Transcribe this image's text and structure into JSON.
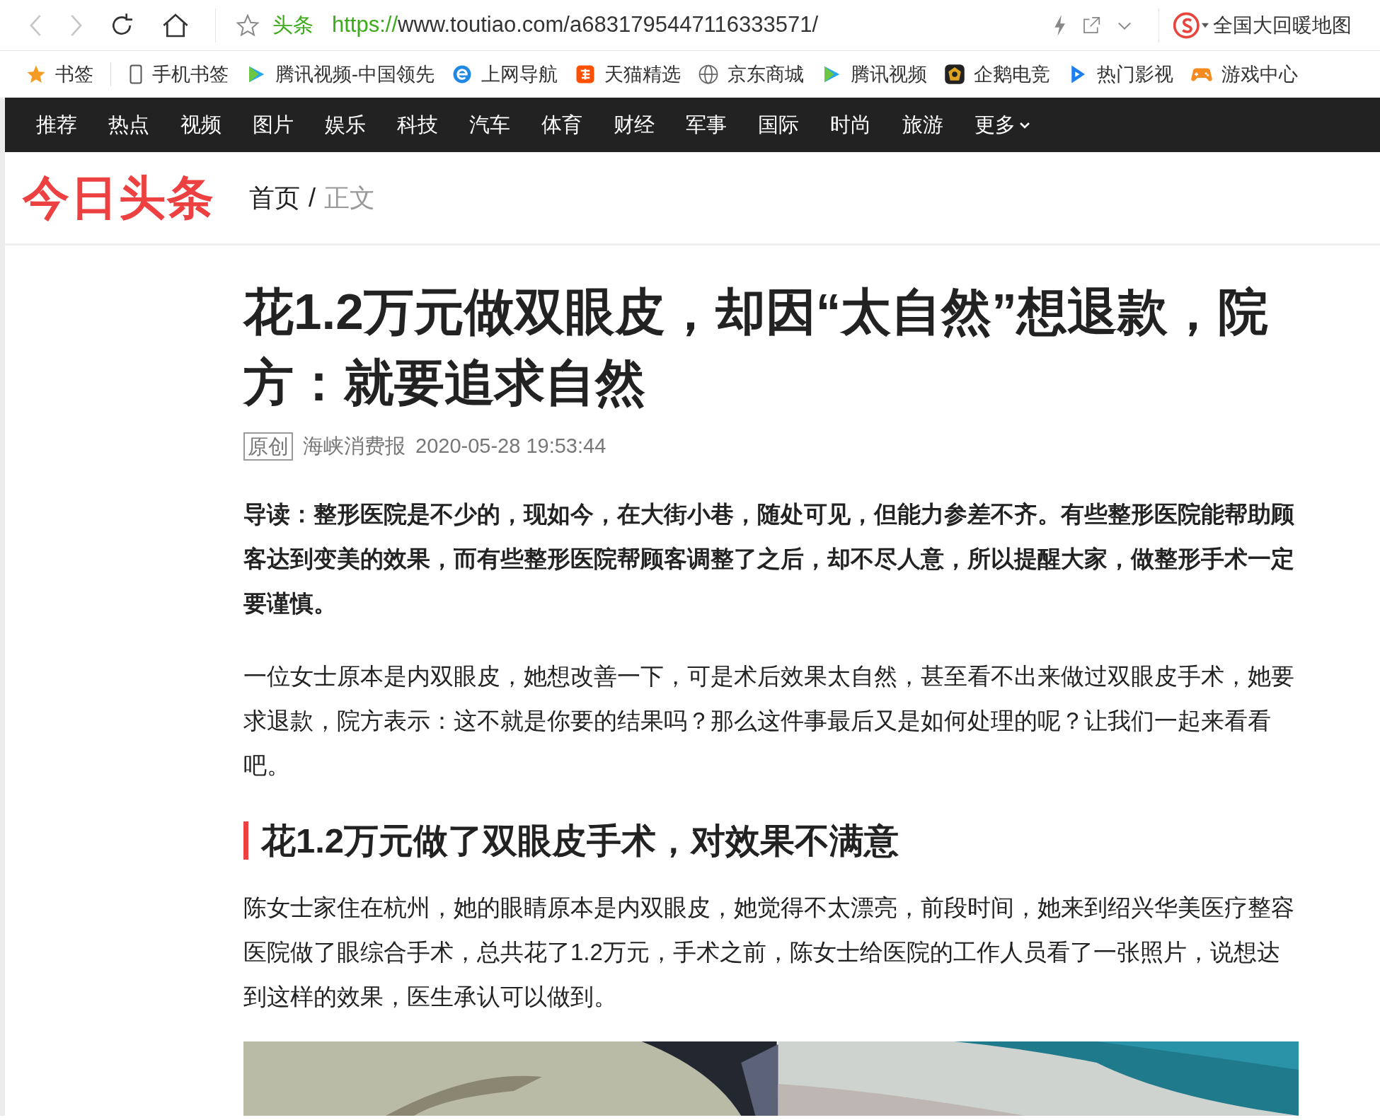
{
  "address_bar": {
    "site_label": "头条",
    "url_scheme": "https://",
    "url_rest": "www.toutiao.com/a6831795447116333571/",
    "search_hint": "全国大回暖地图"
  },
  "bookmarks": [
    {
      "kind": "star",
      "label": "书签"
    },
    {
      "kind": "phone",
      "label": "手机书签"
    },
    {
      "kind": "play",
      "label": "腾讯视频-中国领先"
    },
    {
      "kind": "ie",
      "label": "上网导航"
    },
    {
      "kind": "tao",
      "label": "天猫精选"
    },
    {
      "kind": "globe",
      "label": "京东商城"
    },
    {
      "kind": "play",
      "label": "腾讯视频"
    },
    {
      "kind": "badge",
      "label": "企鹅电竞"
    },
    {
      "kind": "film",
      "label": "热门影视"
    },
    {
      "kind": "game",
      "label": "游戏中心"
    }
  ],
  "nav": [
    "推荐",
    "热点",
    "视频",
    "图片",
    "娱乐",
    "科技",
    "汽车",
    "体育",
    "财经",
    "军事",
    "国际",
    "时尚",
    "旅游"
  ],
  "nav_more": "更多",
  "logo": "今日头条",
  "breadcrumb": {
    "home": "首页",
    "separator": "/",
    "current": "正文"
  },
  "article": {
    "title": "花1.2万元做双眼皮，却因“太自然”想退款，院方：就要追求自然",
    "tag": "原创",
    "source": "海峡消费报",
    "time": "2020-05-28 19:53:44",
    "blocks": [
      {
        "kind": "lead",
        "text": "导读：整形医院是不少的，现如今，在大街小巷，随处可见，但能力参差不齐。有些整形医院能帮助顾客达到变美的效果，而有些整形医院帮顾客调整了之后，却不尽人意，所以提醒大家，做整形手术一定要谨慎。"
      },
      {
        "kind": "paragraph",
        "text": "一位女士原本是内双眼皮，她想改善一下，可是术后效果太自然，甚至看不出来做过双眼皮手术，她要求退款，院方表示：这不就是你要的结果吗？那么这件事最后又是如何处理的呢？让我们一起来看看吧。"
      },
      {
        "kind": "heading",
        "text": "花1.2万元做了双眼皮手术，对效果不满意"
      },
      {
        "kind": "paragraph",
        "text": "陈女士家住在杭州，她的眼睛原本是内双眼皮，她觉得不太漂亮，前段时间，她来到绍兴华美医疗整容医院做了眼综合手术，总共花了1.2万元，手术之前，陈女士给医院的工作人员看了一张照片，说想达到这样的效果，医生承认可以做到。"
      },
      {
        "kind": "picture"
      }
    ]
  }
}
